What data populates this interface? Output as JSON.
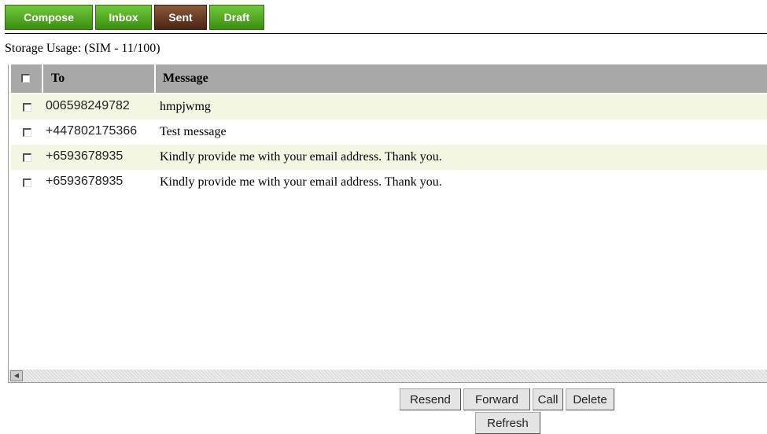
{
  "tabs": [
    {
      "label": "Compose",
      "active": false
    },
    {
      "label": "Inbox",
      "active": false
    },
    {
      "label": "Sent",
      "active": true
    },
    {
      "label": "Draft",
      "active": false
    }
  ],
  "storage_text": "Storage Usage: (SIM - 11/100)",
  "columns": {
    "to": "To",
    "message": "Message"
  },
  "messages": [
    {
      "to": "006598249782",
      "message": "hmpjwmg"
    },
    {
      "to": "+447802175366",
      "message": "Test message"
    },
    {
      "to": "+6593678935",
      "message": "Kindly provide me with your email address. Thank you."
    },
    {
      "to": "+6593678935",
      "message": "Kindly provide me with your email address. Thank you."
    }
  ],
  "actions": {
    "resend": "Resend",
    "forward": "Forward",
    "call": "Call",
    "delete": "Delete",
    "refresh": "Refresh"
  },
  "colors": {
    "tab_green": "#3a8e12",
    "tab_active": "#4a2412",
    "header_gray": "#a8a8a8",
    "row_alt": "#f3f6e2"
  },
  "icons": {
    "scroll_left": "scroll-left-arrow-icon"
  }
}
